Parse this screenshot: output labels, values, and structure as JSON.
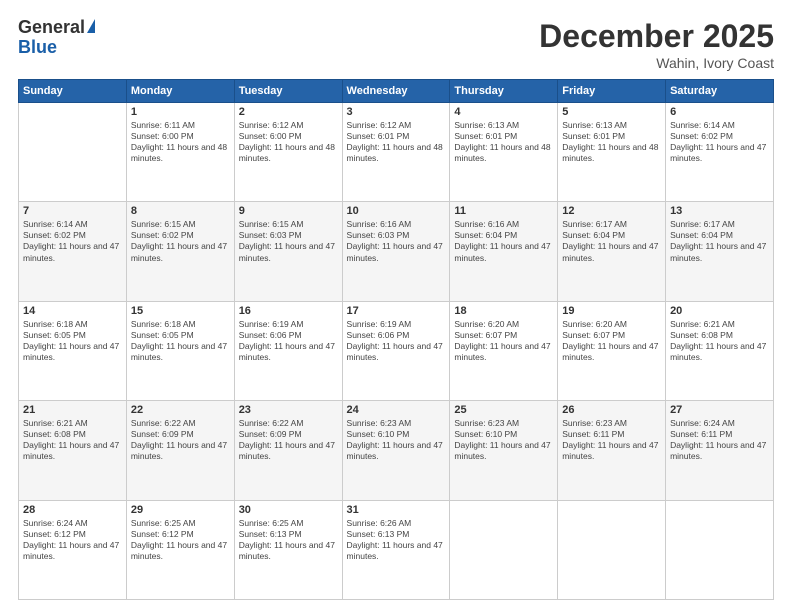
{
  "header": {
    "logo_general": "General",
    "logo_blue": "Blue",
    "month_title": "December 2025",
    "location": "Wahin, Ivory Coast"
  },
  "days_of_week": [
    "Sunday",
    "Monday",
    "Tuesday",
    "Wednesday",
    "Thursday",
    "Friday",
    "Saturday"
  ],
  "weeks": [
    [
      {
        "day": "",
        "empty": true
      },
      {
        "day": "1",
        "sunrise": "Sunrise: 6:11 AM",
        "sunset": "Sunset: 6:00 PM",
        "daylight": "Daylight: 11 hours and 48 minutes."
      },
      {
        "day": "2",
        "sunrise": "Sunrise: 6:12 AM",
        "sunset": "Sunset: 6:00 PM",
        "daylight": "Daylight: 11 hours and 48 minutes."
      },
      {
        "day": "3",
        "sunrise": "Sunrise: 6:12 AM",
        "sunset": "Sunset: 6:01 PM",
        "daylight": "Daylight: 11 hours and 48 minutes."
      },
      {
        "day": "4",
        "sunrise": "Sunrise: 6:13 AM",
        "sunset": "Sunset: 6:01 PM",
        "daylight": "Daylight: 11 hours and 48 minutes."
      },
      {
        "day": "5",
        "sunrise": "Sunrise: 6:13 AM",
        "sunset": "Sunset: 6:01 PM",
        "daylight": "Daylight: 11 hours and 48 minutes."
      },
      {
        "day": "6",
        "sunrise": "Sunrise: 6:14 AM",
        "sunset": "Sunset: 6:02 PM",
        "daylight": "Daylight: 11 hours and 47 minutes."
      }
    ],
    [
      {
        "day": "7",
        "sunrise": "Sunrise: 6:14 AM",
        "sunset": "Sunset: 6:02 PM",
        "daylight": "Daylight: 11 hours and 47 minutes."
      },
      {
        "day": "8",
        "sunrise": "Sunrise: 6:15 AM",
        "sunset": "Sunset: 6:02 PM",
        "daylight": "Daylight: 11 hours and 47 minutes."
      },
      {
        "day": "9",
        "sunrise": "Sunrise: 6:15 AM",
        "sunset": "Sunset: 6:03 PM",
        "daylight": "Daylight: 11 hours and 47 minutes."
      },
      {
        "day": "10",
        "sunrise": "Sunrise: 6:16 AM",
        "sunset": "Sunset: 6:03 PM",
        "daylight": "Daylight: 11 hours and 47 minutes."
      },
      {
        "day": "11",
        "sunrise": "Sunrise: 6:16 AM",
        "sunset": "Sunset: 6:04 PM",
        "daylight": "Daylight: 11 hours and 47 minutes."
      },
      {
        "day": "12",
        "sunrise": "Sunrise: 6:17 AM",
        "sunset": "Sunset: 6:04 PM",
        "daylight": "Daylight: 11 hours and 47 minutes."
      },
      {
        "day": "13",
        "sunrise": "Sunrise: 6:17 AM",
        "sunset": "Sunset: 6:04 PM",
        "daylight": "Daylight: 11 hours and 47 minutes."
      }
    ],
    [
      {
        "day": "14",
        "sunrise": "Sunrise: 6:18 AM",
        "sunset": "Sunset: 6:05 PM",
        "daylight": "Daylight: 11 hours and 47 minutes."
      },
      {
        "day": "15",
        "sunrise": "Sunrise: 6:18 AM",
        "sunset": "Sunset: 6:05 PM",
        "daylight": "Daylight: 11 hours and 47 minutes."
      },
      {
        "day": "16",
        "sunrise": "Sunrise: 6:19 AM",
        "sunset": "Sunset: 6:06 PM",
        "daylight": "Daylight: 11 hours and 47 minutes."
      },
      {
        "day": "17",
        "sunrise": "Sunrise: 6:19 AM",
        "sunset": "Sunset: 6:06 PM",
        "daylight": "Daylight: 11 hours and 47 minutes."
      },
      {
        "day": "18",
        "sunrise": "Sunrise: 6:20 AM",
        "sunset": "Sunset: 6:07 PM",
        "daylight": "Daylight: 11 hours and 47 minutes."
      },
      {
        "day": "19",
        "sunrise": "Sunrise: 6:20 AM",
        "sunset": "Sunset: 6:07 PM",
        "daylight": "Daylight: 11 hours and 47 minutes."
      },
      {
        "day": "20",
        "sunrise": "Sunrise: 6:21 AM",
        "sunset": "Sunset: 6:08 PM",
        "daylight": "Daylight: 11 hours and 47 minutes."
      }
    ],
    [
      {
        "day": "21",
        "sunrise": "Sunrise: 6:21 AM",
        "sunset": "Sunset: 6:08 PM",
        "daylight": "Daylight: 11 hours and 47 minutes."
      },
      {
        "day": "22",
        "sunrise": "Sunrise: 6:22 AM",
        "sunset": "Sunset: 6:09 PM",
        "daylight": "Daylight: 11 hours and 47 minutes."
      },
      {
        "day": "23",
        "sunrise": "Sunrise: 6:22 AM",
        "sunset": "Sunset: 6:09 PM",
        "daylight": "Daylight: 11 hours and 47 minutes."
      },
      {
        "day": "24",
        "sunrise": "Sunrise: 6:23 AM",
        "sunset": "Sunset: 6:10 PM",
        "daylight": "Daylight: 11 hours and 47 minutes."
      },
      {
        "day": "25",
        "sunrise": "Sunrise: 6:23 AM",
        "sunset": "Sunset: 6:10 PM",
        "daylight": "Daylight: 11 hours and 47 minutes."
      },
      {
        "day": "26",
        "sunrise": "Sunrise: 6:23 AM",
        "sunset": "Sunset: 6:11 PM",
        "daylight": "Daylight: 11 hours and 47 minutes."
      },
      {
        "day": "27",
        "sunrise": "Sunrise: 6:24 AM",
        "sunset": "Sunset: 6:11 PM",
        "daylight": "Daylight: 11 hours and 47 minutes."
      }
    ],
    [
      {
        "day": "28",
        "sunrise": "Sunrise: 6:24 AM",
        "sunset": "Sunset: 6:12 PM",
        "daylight": "Daylight: 11 hours and 47 minutes."
      },
      {
        "day": "29",
        "sunrise": "Sunrise: 6:25 AM",
        "sunset": "Sunset: 6:12 PM",
        "daylight": "Daylight: 11 hours and 47 minutes."
      },
      {
        "day": "30",
        "sunrise": "Sunrise: 6:25 AM",
        "sunset": "Sunset: 6:13 PM",
        "daylight": "Daylight: 11 hours and 47 minutes."
      },
      {
        "day": "31",
        "sunrise": "Sunrise: 6:26 AM",
        "sunset": "Sunset: 6:13 PM",
        "daylight": "Daylight: 11 hours and 47 minutes."
      },
      {
        "day": "",
        "empty": true
      },
      {
        "day": "",
        "empty": true
      },
      {
        "day": "",
        "empty": true
      }
    ]
  ]
}
